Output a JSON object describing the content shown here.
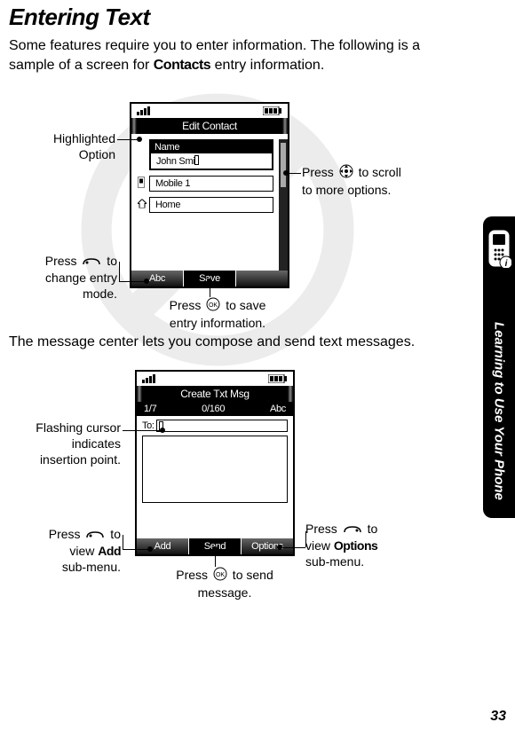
{
  "heading": "Entering Text",
  "intro_a": "Some features require you to enter information. The following is a sample of a screen for ",
  "intro_mono": "Contacts",
  "intro_b": " entry information.",
  "mid_para": "The message center lets you compose and send text messages.",
  "side_label": "Learning to Use Your Phone",
  "page_number": "33",
  "phone1": {
    "title": "Edit Contact",
    "name_label": "Name",
    "name_value": "John Smi",
    "mobile_label": "Mobile 1",
    "home_label": "Home",
    "sk_left": "Abc",
    "sk_center": "Save",
    "sk_right": ""
  },
  "phone2": {
    "title": "Create Txt Msg",
    "info_left": "1/7",
    "info_center": "0/160",
    "info_right": "Abc",
    "to_label": "To:",
    "sk_left": "Add",
    "sk_center": "Send",
    "sk_right": "Options"
  },
  "callouts": {
    "highlighted1": "Highlighted",
    "highlighted2": "Option",
    "scroll1": "Press ",
    "scroll2": " to scroll",
    "scroll3": "to more options.",
    "mode1": "Press ",
    "mode2": " to",
    "mode3": "change entry",
    "mode4": "mode.",
    "save1": "Press ",
    "save2": " to save",
    "save3": "entry information.",
    "cursor1": "Flashing cursor",
    "cursor2": "indicates",
    "cursor3": "insertion point.",
    "options1": "Press ",
    "options2": " to",
    "options3": "view ",
    "options_mono": "Options",
    "options4": "sub-menu.",
    "add1": "Press ",
    "add2": " to",
    "add3": "view ",
    "add_mono": "Add",
    "add4": "sub-menu.",
    "send1": "Press ",
    "send2": " to send",
    "send3": "message."
  }
}
